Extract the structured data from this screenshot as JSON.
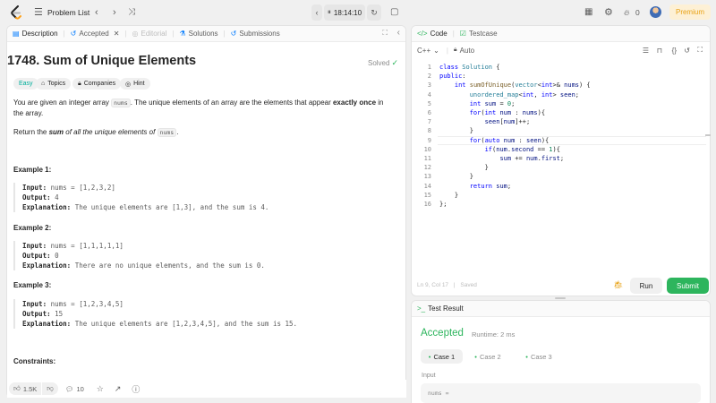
{
  "nav": {
    "problem_list": "Problem List",
    "timer": "18:14:10",
    "streak_count": "0",
    "premium": "Premium"
  },
  "left_tabs": {
    "description": "Description",
    "accepted": "Accepted",
    "editorial": "Editorial",
    "solutions": "Solutions",
    "submissions": "Submissions"
  },
  "problem": {
    "title": "1748. Sum of Unique Elements",
    "status": "Solved",
    "difficulty": "Easy",
    "topics": "Topics",
    "companies": "Companies",
    "hint": "Hint",
    "p1_a": "You are given an integer array ",
    "p1_code": "nums",
    "p1_b": ". The unique elements of an array are the elements that appear ",
    "p1_bold": "exactly once",
    "p1_c": " in the array.",
    "p2_a": "Return the ",
    "p2_bold": "sum",
    "p2_b": " of all the unique elements of ",
    "p2_code": "nums",
    "p2_c": ".",
    "examples": [
      {
        "head": "Example 1:",
        "input_label": "Input:",
        "input": " nums = [1,2,3,2]",
        "output_label": "Output:",
        "output": " 4",
        "expl_label": "Explanation:",
        "expl": " The unique elements are [1,3], and the sum is 4."
      },
      {
        "head": "Example 2:",
        "input_label": "Input:",
        "input": " nums = [1,1,1,1,1]",
        "output_label": "Output:",
        "output": " 0",
        "expl_label": "Explanation:",
        "expl": " There are no unique elements, and the sum is 0."
      },
      {
        "head": "Example 3:",
        "input_label": "Input:",
        "input": " nums = [1,2,3,4,5]",
        "output_label": "Output:",
        "output": " 15",
        "expl_label": "Explanation:",
        "expl": " The unique elements are [1,2,3,4,5], and the sum is 15."
      }
    ],
    "constraints": "Constraints:"
  },
  "footer": {
    "likes": "1.5K",
    "comments": "10"
  },
  "code_panel": {
    "code_tab": "Code",
    "testcase_tab": "Testcase",
    "language": "C++",
    "auto": "Auto",
    "line_numbers": [
      "1",
      "2",
      "3",
      "4",
      "5",
      "6",
      "7",
      "8",
      "9",
      "10",
      "11",
      "12",
      "13",
      "14",
      "15",
      "16"
    ],
    "status_line": "Ln 9, Col 17",
    "saved": "Saved",
    "run": "Run",
    "submit": "Submit"
  },
  "result_panel": {
    "title": "Test Result",
    "verdict": "Accepted",
    "runtime": "Runtime: 2 ms",
    "cases": [
      "Case 1",
      "Case 2",
      "Case 3"
    ],
    "input_label": "Input",
    "input_value": "nums ="
  },
  "colors": {
    "accent_green": "#2db55d",
    "easy_teal": "#00af9b",
    "premium_orange": "#e8a215",
    "link_blue": "#007aff"
  }
}
